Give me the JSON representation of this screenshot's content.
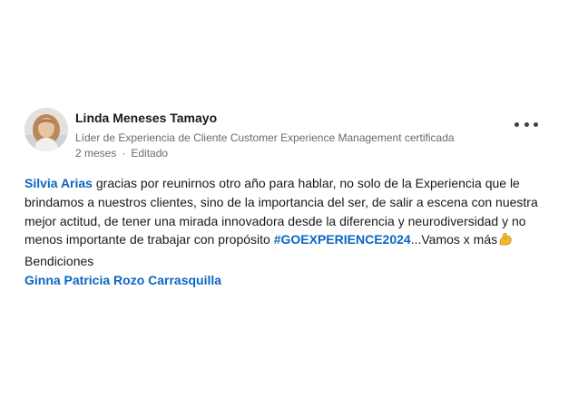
{
  "post": {
    "author": {
      "name": "Linda Meneses Tamayo",
      "headline": "Líder de Experiencia de Cliente Customer Experience Management certificada",
      "time": "2 meses",
      "separator": "·",
      "edited": "Editado",
      "avatar_icon": "profile-photo-icon"
    },
    "more_icon": "more-options-icon",
    "body": {
      "mention_1": "Silvia Arias",
      "line_1_rest": " gracias por reunirnos otro año para hablar, no solo de la Experiencia que le",
      "line_2": "brindamos a nuestros clientes, sino de la importancia del ser, de salir a escena con nuestra",
      "line_3": "mejor actitud, de tener una mirada innovadora desde la diferencia y neurodiversidad y no",
      "line_4_start": "menos importante de trabajar con propósito ",
      "hashtag": "#GOEXPERIENCE2024",
      "line_4_end": "...Vamos x más",
      "emoji_icon": "flexed-biceps-icon",
      "line_5": "Bendiciones",
      "mention_2": "Ginna Patricia Rozo Carrasquilla"
    },
    "colors": {
      "link": "#0a66c2",
      "text": "#191919",
      "secondary": "#666666"
    }
  }
}
